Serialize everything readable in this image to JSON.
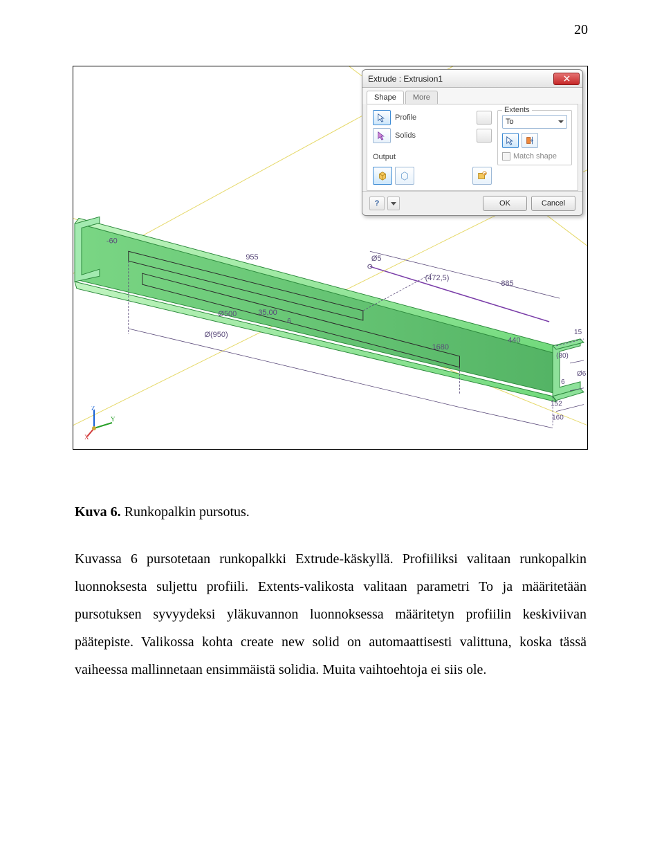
{
  "page_number": "20",
  "figure": {
    "dialog": {
      "title": "Extrude : Extrusion1",
      "tabs": [
        "Shape",
        "More"
      ],
      "profile_label": "Profile",
      "solids_label": "Solids",
      "output_label": "Output",
      "extents_label": "Extents",
      "extents_value": "To",
      "match_shape_label": "Match shape",
      "ok": "OK",
      "cancel": "Cancel",
      "help_symbol": "?"
    },
    "triad": {
      "x": "X",
      "y": "Y",
      "z": "Z"
    },
    "dims": {
      "neg60": "-60",
      "d955": "955",
      "d5": "Ø5",
      "p4725": "(472,5)",
      "d885": "885",
      "d500": "Ø500",
      "d35": "35,00",
      "d6a": "6",
      "p950": "Ø(950)",
      "d1680": "1680",
      "d440": "440",
      "d15": "15",
      "p80": "(80)",
      "d6b": "Ø6",
      "d6c": "6",
      "d152": "152",
      "d160": "160"
    }
  },
  "caption_bold": "Kuva 6.",
  "caption_rest": " Runkopalkin pursotus.",
  "paragraph": "Kuvassa 6 pursotetaan runkopalkki Extrude-käskyllä. Profiiliksi valitaan runkopalkin luonnoksesta suljettu profiili. Extents-valikosta valitaan parametri To ja määritetään pursotuksen syvyydeksi yläkuvannon luonnoksessa määritetyn profiilin keskiviivan päätepiste. Valikossa kohta create new solid on automaattisesti valittuna, koska tässä vaiheessa mallinnetaan ensimmäistä solidia. Muita vaihtoehtoja ei siis ole."
}
